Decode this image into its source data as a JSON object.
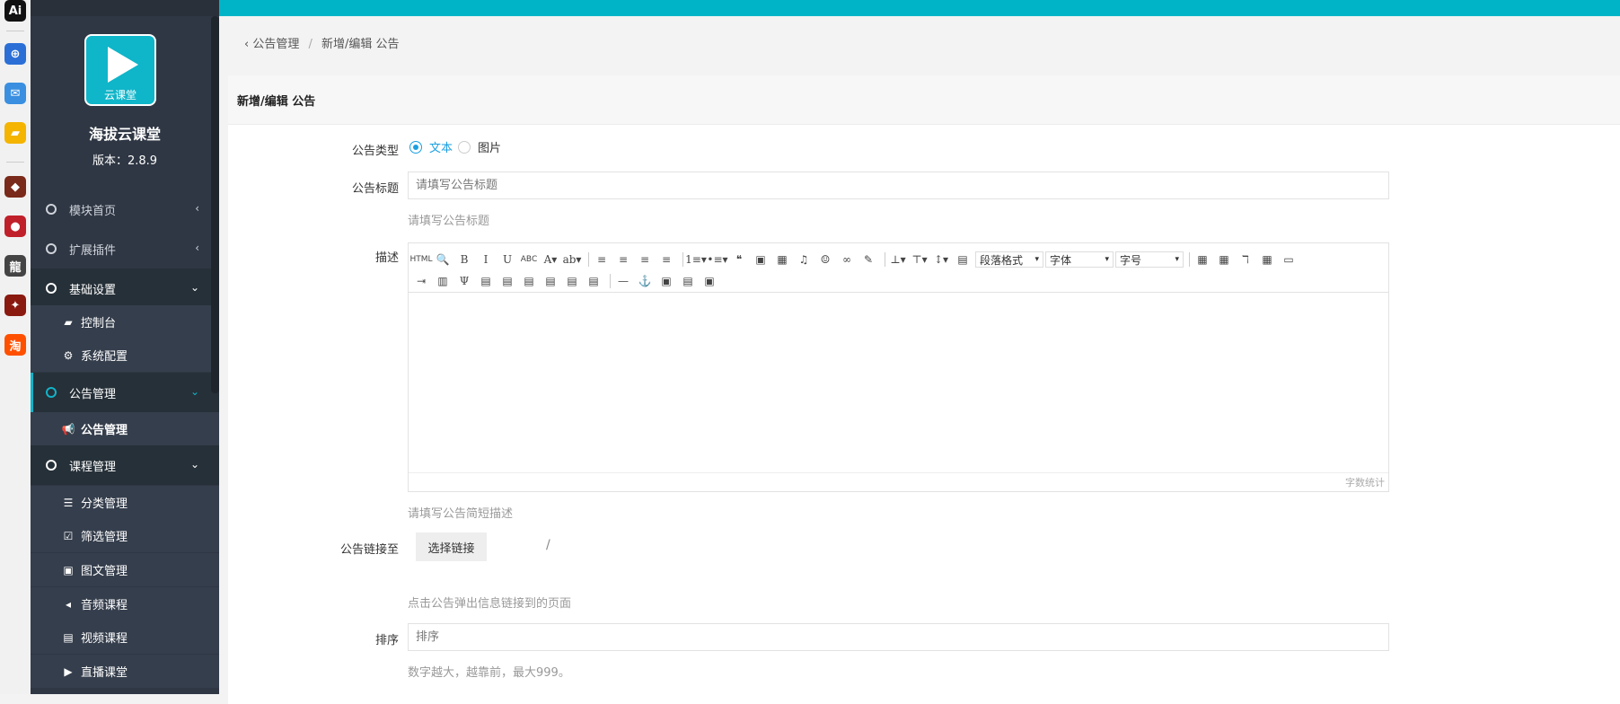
{
  "apps": [
    {
      "name": "ai-app-icon",
      "bg": "#111111",
      "glyph": "Ai"
    },
    {
      "name": "app-icon-blue-1",
      "bg": "#2b6fd6",
      "glyph": "⊕"
    },
    {
      "name": "app-icon-vscode",
      "bg": "#3a8fe0",
      "glyph": "✉"
    },
    {
      "name": "app-icon-folder",
      "bg": "#f4b400",
      "glyph": "▰"
    },
    {
      "name": "app-icon-game-1",
      "bg": "#7a2a1a",
      "glyph": "◆"
    },
    {
      "name": "app-icon-ball",
      "bg": "#c0202a",
      "glyph": "●"
    },
    {
      "name": "app-icon-dragon",
      "bg": "#444444",
      "glyph": "龍"
    },
    {
      "name": "app-icon-game-2",
      "bg": "#8a1a10",
      "glyph": "✦"
    },
    {
      "name": "app-icon-taobao",
      "bg": "#ff5000",
      "glyph": "淘"
    }
  ],
  "sidebar": {
    "logo_text": "云课堂",
    "brand_name": "海拔云课堂",
    "version": "版本：2.8.9",
    "groups": [
      {
        "label": "模块首页",
        "chevron": "‹"
      },
      {
        "label": "扩展插件",
        "chevron": "‹"
      },
      {
        "label": "基础设置",
        "chevron": "⌄"
      },
      {
        "label": "公告管理",
        "chevron": "⌄"
      },
      {
        "label": "课程管理",
        "chevron": "⌄"
      }
    ],
    "subs": [
      {
        "label": "控制台",
        "icon": "▰"
      },
      {
        "label": "系统配置",
        "icon": "⚙"
      },
      {
        "label": "公告管理",
        "icon": "📢"
      },
      {
        "label": "分类管理",
        "icon": "☰"
      },
      {
        "label": "筛选管理",
        "icon": "☑"
      },
      {
        "label": "图文管理",
        "icon": "▣"
      },
      {
        "label": "音频课程",
        "icon": "◂"
      },
      {
        "label": "视频课程",
        "icon": "▤"
      },
      {
        "label": "直播课堂",
        "icon": "▶"
      }
    ]
  },
  "breadcrumb": {
    "back": "‹",
    "parent": "公告管理",
    "separator": "/",
    "current": "新增/编辑 公告"
  },
  "card": {
    "title": "新增/编辑 公告"
  },
  "form": {
    "type_label": "公告类型",
    "type_text": "文本",
    "type_image": "图片",
    "title_label": "公告标题",
    "title_placeholder": "请填写公告标题",
    "title_help": "请填写公告标题",
    "desc_label": "描述",
    "desc_help": "请填写公告简短描述",
    "word_count": "字数统计",
    "link_label": "公告链接至",
    "link_button": "选择链接",
    "link_value": "/",
    "link_help": "点击公告弹出信息链接到的页面",
    "sort_label": "排序",
    "sort_placeholder": "排序",
    "sort_help": "数字越大，越靠前，最大999。"
  },
  "editor": {
    "row1": [
      "HTML",
      "🔍",
      "B",
      "I",
      "U",
      "ABC",
      "A▾",
      "ab▾",
      "|",
      "≡",
      "≡",
      "≡",
      "≡",
      "|",
      "1≡▾",
      "•≡▾",
      "❝",
      "▣",
      "▦",
      "♫",
      "☺",
      "∞",
      "✎",
      "|",
      "⊥▾",
      "⊤▾",
      "↕▾",
      "▤"
    ],
    "paragraph_select": "段落格式",
    "font_select": "字体",
    "size_select": "字号",
    "row1_tail": [
      "▦",
      "▦",
      "ℸ",
      "▦",
      "▭"
    ],
    "row2": [
      "⇥",
      "▥",
      "Ψ",
      "▤",
      "▤",
      "▤",
      "▤",
      "▤",
      "▤",
      "|",
      "—",
      "⚓",
      "▣",
      "▤",
      "▣"
    ]
  }
}
